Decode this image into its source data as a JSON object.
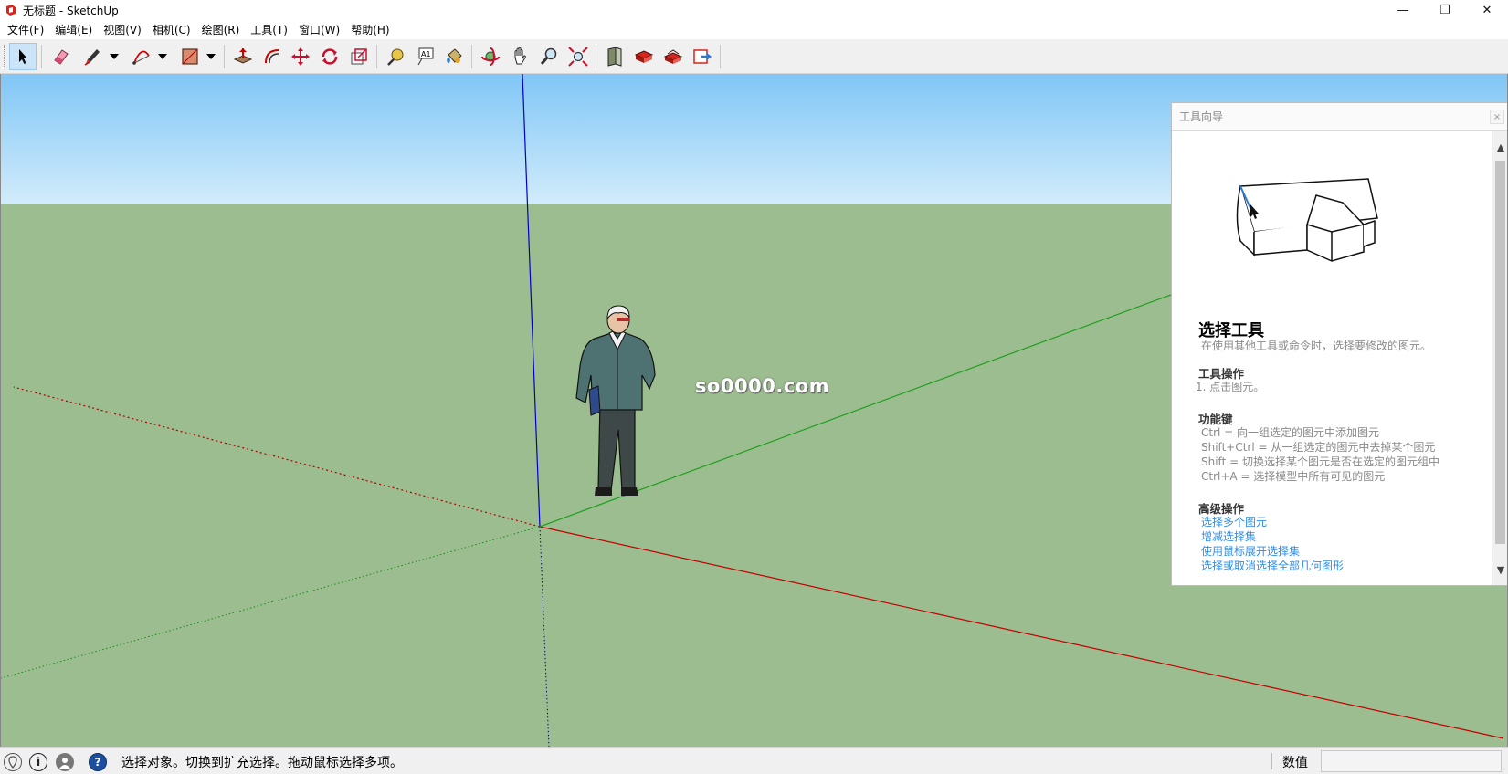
{
  "window": {
    "title": "无标题 - SketchUp",
    "minimize": "—",
    "restore": "❐",
    "close": "✕"
  },
  "menu": [
    {
      "label": "文件(F)"
    },
    {
      "label": "编辑(E)"
    },
    {
      "label": "视图(V)"
    },
    {
      "label": "相机(C)"
    },
    {
      "label": "绘图(R)"
    },
    {
      "label": "工具(T)"
    },
    {
      "label": "窗口(W)"
    },
    {
      "label": "帮助(H)"
    }
  ],
  "toolbar": {
    "active_tool": "select",
    "tools": [
      {
        "icon": "select-arrow-icon"
      },
      {
        "icon": "eraser-icon"
      },
      {
        "icon": "pencil-line-icon"
      },
      {
        "icon": "arc-icon"
      },
      {
        "icon": "rectangle-icon"
      },
      {
        "icon": "push-pull-icon"
      },
      {
        "icon": "offset-icon"
      },
      {
        "icon": "move-icon"
      },
      {
        "icon": "rotate-icon"
      },
      {
        "icon": "scale-icon"
      },
      {
        "icon": "tape-measure-icon"
      },
      {
        "icon": "text-icon"
      },
      {
        "icon": "paint-bucket-icon"
      },
      {
        "icon": "orbit-icon"
      },
      {
        "icon": "pan-icon"
      },
      {
        "icon": "zoom-icon"
      },
      {
        "icon": "zoom-extents-icon"
      },
      {
        "icon": "3d-warehouse-icon"
      },
      {
        "icon": "extension-warehouse-icon"
      },
      {
        "icon": "layout-icon"
      },
      {
        "icon": "send-to-layout-icon"
      }
    ]
  },
  "viewport": {
    "watermark": "so0000.com",
    "sky_color": "#80c6f6",
    "ground_color": "#9cbd8f",
    "axis_colors": {
      "red": "#c40000",
      "green": "#1ea01e",
      "blue": "#0000c8"
    }
  },
  "instructor": {
    "title": "工具向导",
    "close": "×",
    "tool_name": "选择工具",
    "description": "在使用其他工具或命令时，选择要修改的图元。",
    "operations_title": "工具操作",
    "operations": [
      "1.   点击图元。"
    ],
    "modifiers_title": "功能键",
    "modifiers": [
      "Ctrl = 向一组选定的图元中添加图元",
      "Shift+Ctrl = 从一组选定的图元中去掉某个图元",
      "Shift = 切换选择某个图元是否在选定的图元组中",
      "Ctrl+A = 选择模型中所有可见的图元"
    ],
    "advanced_title": "高级操作",
    "advanced_links": [
      "选择多个图元",
      "增减选择集",
      "使用鼠标展开选择集",
      "选择或取消选择全部几何图形"
    ]
  },
  "statusbar": {
    "message": "选择对象。切换到扩充选择。拖动鼠标选择多项。",
    "measurements_label": "数值",
    "measurements_value": "",
    "icons": [
      "geo-location-icon",
      "credits-info-icon",
      "user-account-icon",
      "help-icon"
    ]
  }
}
